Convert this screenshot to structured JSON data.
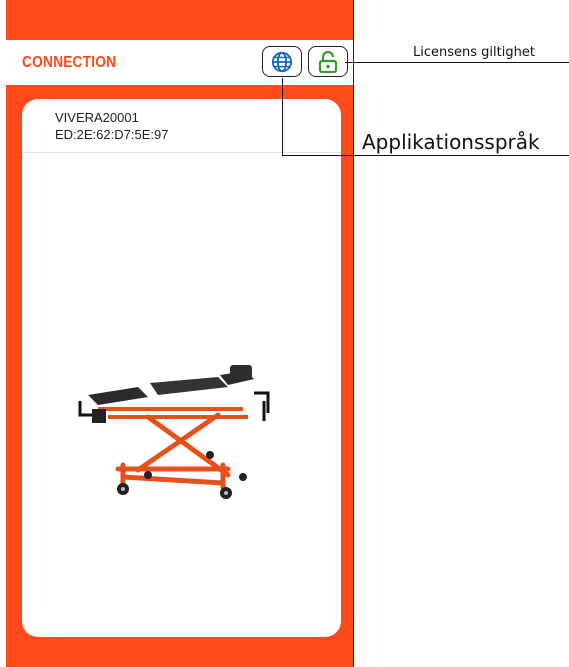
{
  "appbar": {
    "title": "CONNECTION"
  },
  "icons": {
    "language": "globe-icon",
    "license": "unlocked-padlock-icon"
  },
  "colors": {
    "accent": "#ff4a1c",
    "globe": "#1565c0",
    "license": "#2e9e2e"
  },
  "device": {
    "name": "VIVERA20001",
    "mac": "ED:2E:62:D7:5E:97"
  },
  "annotations": {
    "license": "Licensens giltighet",
    "language": "Applikationsspråk"
  }
}
